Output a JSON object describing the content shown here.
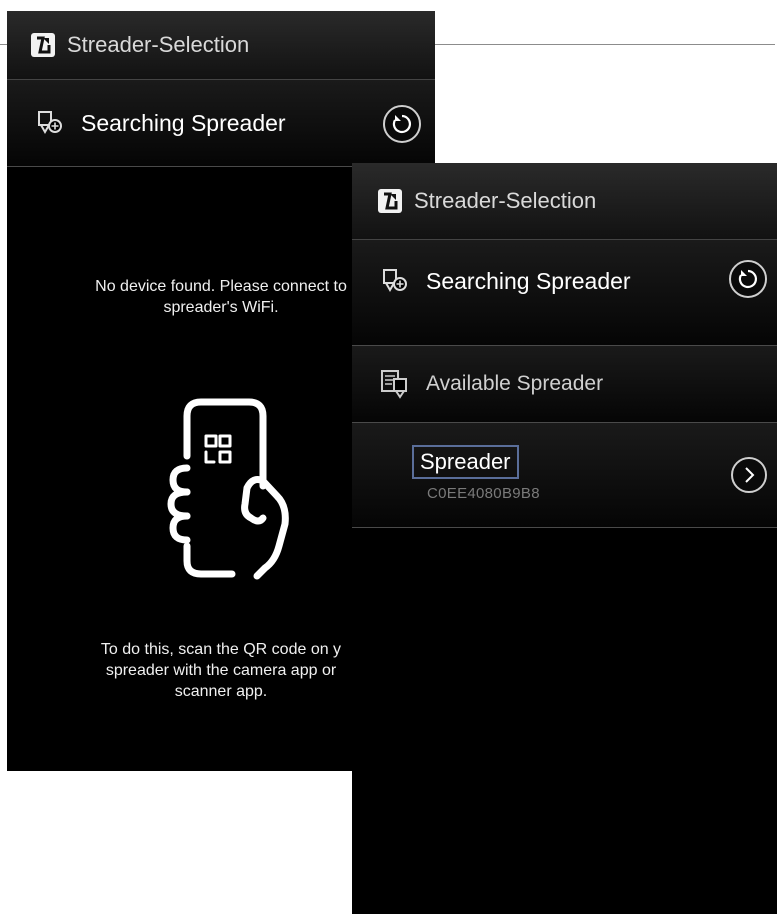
{
  "left_screen": {
    "title": "Streader-Selection",
    "searching_label": "Searching Spreader",
    "no_device_message": "No device found. Please connect to\nspreader's WiFi.",
    "scan_instructions": "To do this, scan the QR code on y\nspreader with the camera app or\nscanner app."
  },
  "right_screen": {
    "title": "Streader-Selection",
    "searching_label": "Searching Spreader",
    "available_label": "Available Spreader",
    "devices": [
      {
        "name": "Spreader",
        "id": "C0EE4080B9B8"
      }
    ]
  },
  "icons": {
    "logo": "app-logo-icon",
    "searching": "spreader-search-icon",
    "refresh": "refresh-icon",
    "available": "spreader-list-icon",
    "chevron": "chevron-right-icon",
    "qr_hand": "phone-qr-hand-icon"
  },
  "colors": {
    "background": "#000000",
    "text": "#ffffff",
    "device_id": "#7a7a7a",
    "selection_border": "#5a6e9a"
  }
}
